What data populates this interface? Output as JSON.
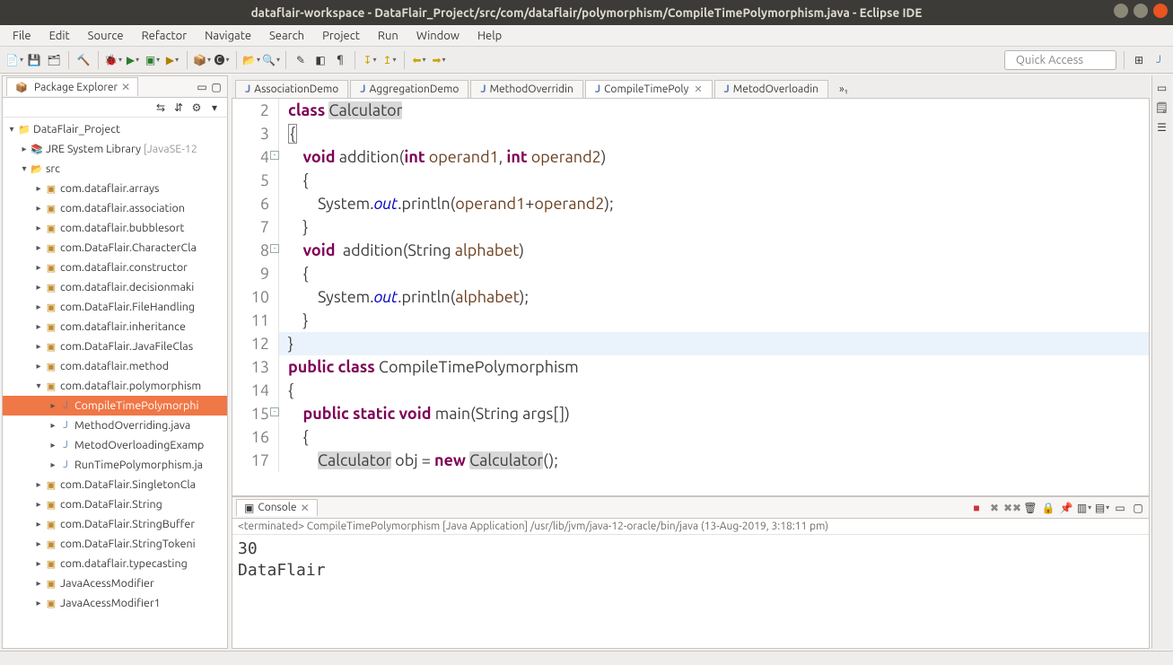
{
  "window": {
    "title": "dataflair-workspace - DataFlair_Project/src/com/dataflair/polymorphism/CompileTimePolymorphism.java - Eclipse IDE"
  },
  "menu": [
    "File",
    "Edit",
    "Source",
    "Refactor",
    "Navigate",
    "Search",
    "Project",
    "Run",
    "Window",
    "Help"
  ],
  "quick_access_placeholder": "Quick Access",
  "package_explorer": {
    "title": "Package Explorer",
    "project": "DataFlair_Project",
    "jre": {
      "label": "JRE System Library",
      "profile": "[JavaSE-12"
    },
    "src_label": "src",
    "packages": [
      "com.dataflair.arrays",
      "com.dataflair.association",
      "com.dataflair.bubblesort",
      "com.DataFlair.CharacterCla",
      "com.dataflair.constructor",
      "com.dataflair.decisionmaki",
      "com.DataFlair.FileHandling",
      "com.dataflair.inheritance",
      "com.DataFlair.JavaFileClas",
      "com.dataflair.method"
    ],
    "open_package": "com.dataflair.polymorphism",
    "open_package_files": [
      "CompileTimePolymorphi",
      "MethodOverriding.java",
      "MetodOverloadingExamp",
      "RunTimePolymorphism.ja"
    ],
    "packages_after": [
      "com.DataFlair.SingletonCla",
      "com.DataFlair.String",
      "com.DataFlair.StringBuffer",
      "com.DataFlair.StringTokeni",
      "com.dataflair.typecasting",
      "JavaAcessModifier",
      "JavaAcessModifier1"
    ]
  },
  "editor_tabs": [
    {
      "label": "AssociationDemo",
      "active": false
    },
    {
      "label": "AggregationDemo",
      "active": false
    },
    {
      "label": "MethodOverridin",
      "active": false
    },
    {
      "label": "CompileTimePoly",
      "active": true
    },
    {
      "label": "MetodOverloadin",
      "active": false
    }
  ],
  "editor_more": "»₁",
  "code_tokens": {
    "l2": {
      "kw1": "class",
      "id": "Calculator"
    },
    "l3": "{",
    "l4": {
      "kw": "void",
      "name": "addition",
      "kw2": "int",
      "p1": "operand1",
      "kw3": "int",
      "p2": "operand2"
    },
    "l5": "    {",
    "l6": {
      "pre": "        System.",
      "out": "out",
      "mid": ".println(",
      "a": "operand1",
      "plus": "+",
      "b": "operand2",
      "end": ");"
    },
    "l7": "    }",
    "l8": {
      "kw": "void",
      "name": "addition",
      "ptype": "String",
      "p": "alphabet"
    },
    "l9": "    {",
    "l10": {
      "pre": "        System.",
      "out": "out",
      "mid": ".println(",
      "a": "alphabet",
      "end": ");"
    },
    "l11": "    }",
    "l12": "}",
    "l13": {
      "kw1": "public",
      "kw2": "class",
      "id": "CompileTimePolymorphism"
    },
    "l14": "{",
    "l15": {
      "kw1": "public",
      "kw2": "static",
      "kw3": "void",
      "name": "main",
      "sig": "(String args[])"
    },
    "l16": "    {",
    "l17": {
      "pre": "        ",
      "t1": "Calculator",
      "mid": " obj = ",
      "kw": "new",
      "sp": " ",
      "t2": "Calculator",
      "end": "();"
    }
  },
  "line_numbers": [
    "2",
    "3",
    "4",
    "5",
    "6",
    "7",
    "8",
    "9",
    "10",
    "11",
    "12",
    "13",
    "14",
    "15",
    "16",
    "17"
  ],
  "console": {
    "title": "Console",
    "info": "<terminated> CompileTimePolymorphism [Java Application] /usr/lib/jvm/java-12-oracle/bin/java (13-Aug-2019, 3:18:11 pm)",
    "output": "30\nDataFlair"
  }
}
